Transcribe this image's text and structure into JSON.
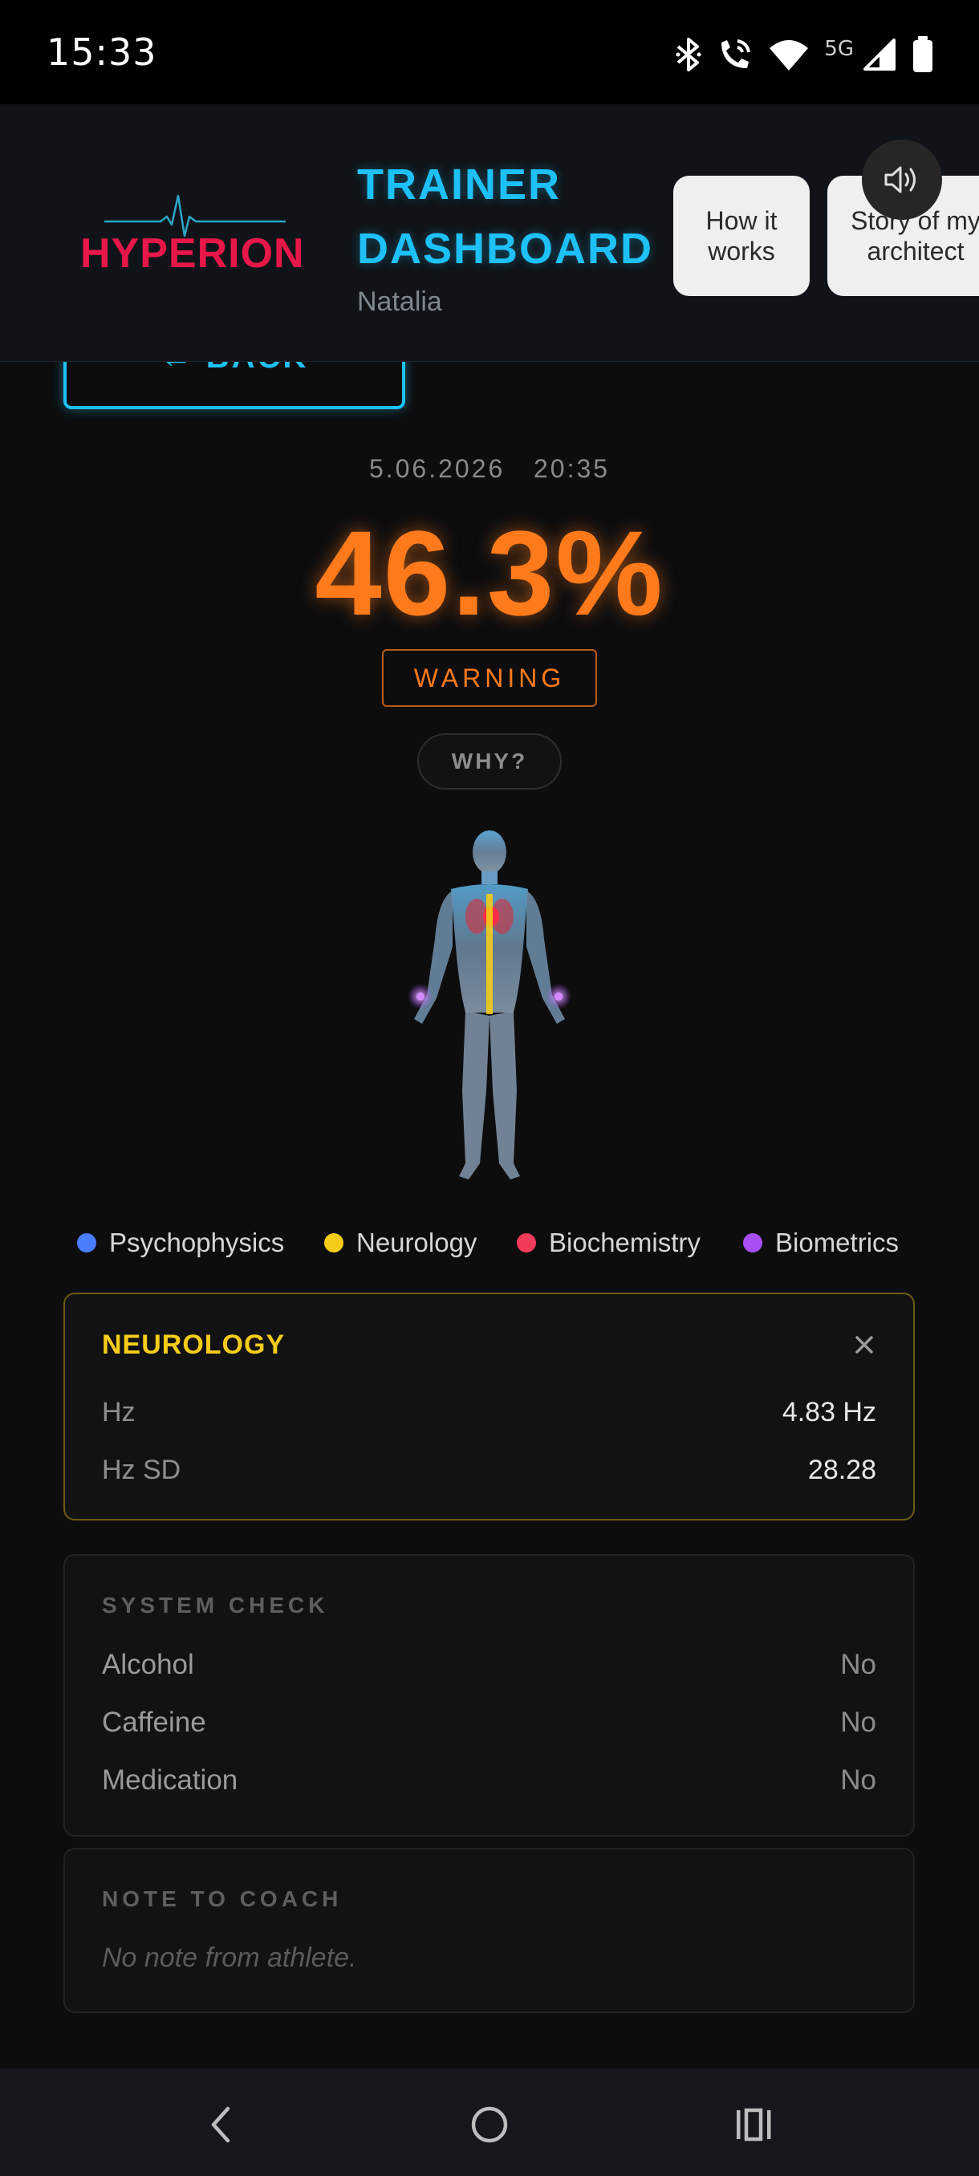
{
  "status_bar": {
    "time": "15:33",
    "network": "5G",
    "icons": [
      "bluetooth-icon",
      "wifi-call-icon",
      "wifi-icon",
      "signal-icon",
      "battery-icon"
    ]
  },
  "header": {
    "logo_text": "HYPERION",
    "title_line1": "TRAINER",
    "title_line2": "DASHBOARD",
    "user_name": "Natalia",
    "how_it_works": "How it works",
    "story_button": "Story of my architect",
    "sound_icon": "speaker-icon"
  },
  "back_button": {
    "label": "← BACK"
  },
  "reading": {
    "date": "5.06.2026",
    "time": "20:35",
    "score": "46.3%",
    "status": "WARNING",
    "why_label": "WHY?"
  },
  "legend": [
    {
      "label": "Psychophysics",
      "color": "#4a7dff"
    },
    {
      "label": "Neurology",
      "color": "#f5cc1a"
    },
    {
      "label": "Biochemistry",
      "color": "#f23a5a"
    },
    {
      "label": "Biometrics",
      "color": "#a84ef5"
    }
  ],
  "neurology_card": {
    "title": "NEUROLOGY",
    "rows": [
      {
        "label": "Hz",
        "value": "4.83 Hz"
      },
      {
        "label": "Hz SD",
        "value": "28.28"
      }
    ]
  },
  "system_check": {
    "title": "SYSTEM CHECK",
    "rows": [
      {
        "label": "Alcohol",
        "value": "No"
      },
      {
        "label": "Caffeine",
        "value": "No"
      },
      {
        "label": "Medication",
        "value": "No"
      }
    ]
  },
  "note": {
    "title": "NOTE TO COACH",
    "text": "No note from athlete."
  },
  "colors": {
    "accent_cyan": "#1ec1f7",
    "brand_red": "#e8174a",
    "warning_orange": "#ff7a1a",
    "neurology_yellow": "#f5cc1a"
  }
}
